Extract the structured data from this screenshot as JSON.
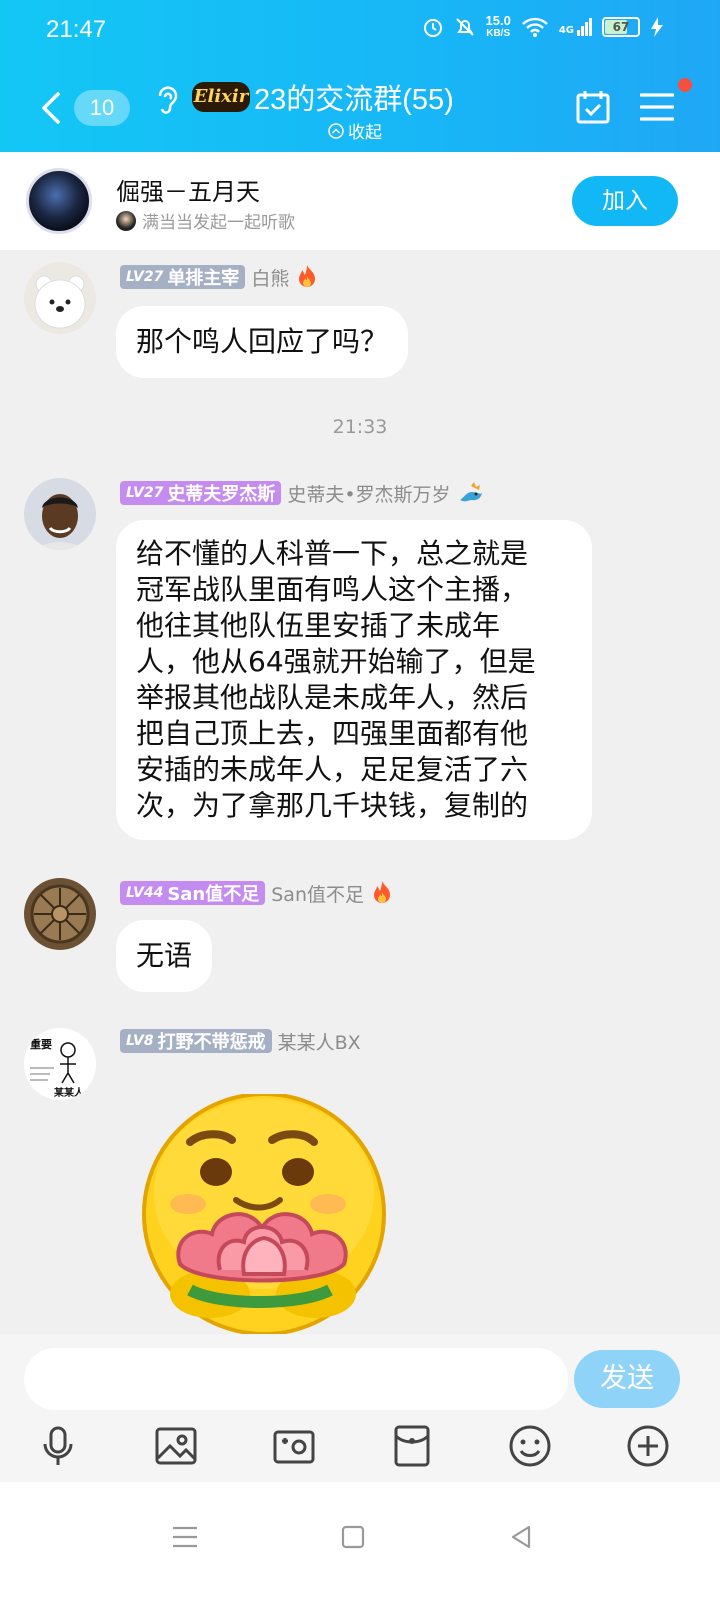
{
  "status_bar": {
    "time": "21:47",
    "speed_value": "15.0",
    "speed_unit": "KB/S",
    "network": "4G",
    "battery": "67"
  },
  "nav": {
    "unread_count": "10",
    "brand_tag": "Elixir",
    "group_title": "23的交流群(55)",
    "collapse_label": "收起"
  },
  "banner": {
    "song_title": "倔强－五月天",
    "subtitle": "满当当发起一起听歌",
    "join_label": "加入"
  },
  "messages": [
    {
      "level": "LV27",
      "title": "单排主宰",
      "nickname": "白熊",
      "nick_icon": "fire-icon",
      "text": "那个鸣人回应了吗？"
    },
    {
      "level": "LV27",
      "title": "史蒂夫罗杰斯",
      "nickname": "史蒂夫•罗杰斯万岁",
      "nick_icon": "dragon-icon",
      "lines": [
        "给不懂的人科普一下，总之就是",
        "冠军战队里面有鸣人这个主播，",
        "他往其他队伍里安插了未成年",
        "人，他从64强就开始输了，但是",
        "举报其他战队是未成年人，然后",
        "把自己顶上去，四强里面都有他",
        "安插的未成年人，足足复活了六",
        "次，为了拿那几千块钱，复制的"
      ]
    },
    {
      "level": "LV44",
      "title": "San值不足",
      "nickname": "San值不足",
      "nick_icon": "fire-icon",
      "text": "无语"
    },
    {
      "level": "LV8",
      "title": "打野不带惩戒",
      "nickname": "某某人BX",
      "sticker": "smiley-with-lotus-sticker"
    }
  ],
  "timestamp": "21:33",
  "meme_avatar": {
    "line1": "重要",
    "line2": "某某人"
  },
  "input": {
    "placeholder": "",
    "send_label": "发送"
  },
  "colors": {
    "header": "#18b6f6",
    "accent": "#12b7f5",
    "send_disabled": "#8fd3f8",
    "badge_gray": "#a6b0c4",
    "badge_purple": "#c48cf0"
  }
}
